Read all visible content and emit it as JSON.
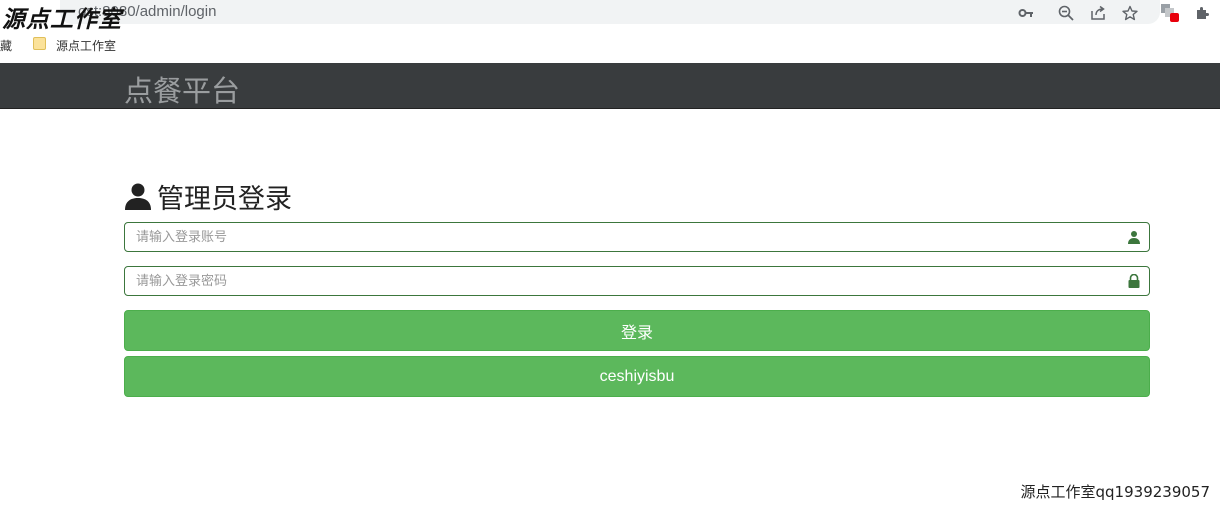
{
  "browser": {
    "url": "localhost:8080/admin/login",
    "url_visible": "ost:8080/admin/login",
    "bookmarks": {
      "left_label": "收藏",
      "left_visible": "藏",
      "folder_label": "源点工作室"
    }
  },
  "watermark": {
    "top": "源点工作室",
    "bottom": "源点工作室qq1939239057"
  },
  "navbar": {
    "brand": "点餐平台"
  },
  "login": {
    "title": "管理员登录",
    "account": {
      "placeholder": "请输入登录账号",
      "value": ""
    },
    "password": {
      "placeholder": "请输入登录密码",
      "value": ""
    },
    "submit_label": "登录",
    "test_label": "ceshiyisbu"
  },
  "colors": {
    "navbar_bg": "#393c3e",
    "brand_text": "#9a9d9f",
    "button_green": "#5cb85c",
    "field_border": "#3c763d",
    "field_icon": "#3c763d"
  },
  "icons": {
    "title": "user-icon",
    "account_field": "user-icon",
    "password_field": "lock-icon",
    "address_bar": [
      "key-icon",
      "zoom-out-icon",
      "share-icon",
      "star-icon",
      "extension-profile-icon",
      "puzzle-icon"
    ]
  }
}
